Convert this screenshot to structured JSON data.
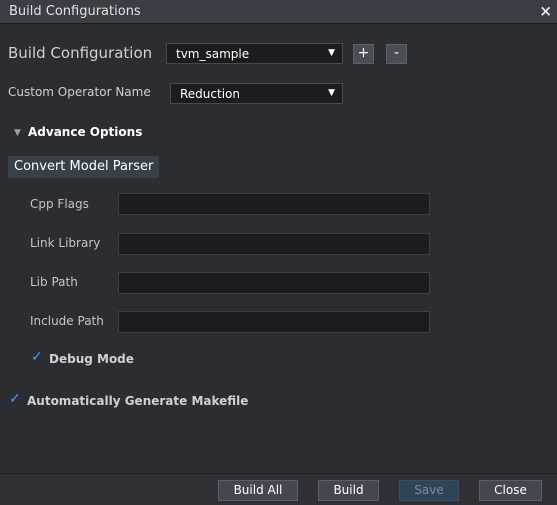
{
  "window": {
    "title": "Build Configurations"
  },
  "build_config": {
    "label": "Build Configuration",
    "value": "tvm_sample",
    "add_label": "+",
    "remove_label": "-"
  },
  "operator": {
    "label": "Custom Operator Name",
    "value": "Reduction"
  },
  "advance": {
    "title": "Advance Options",
    "tab_label": "Convert Model Parser",
    "fields": [
      {
        "label": "Cpp Flags",
        "value": ""
      },
      {
        "label": "Link Library",
        "value": ""
      },
      {
        "label": "Lib Path",
        "value": ""
      },
      {
        "label": "Include Path",
        "value": ""
      }
    ],
    "debug_mode": {
      "label": "Debug Mode",
      "checked": true
    }
  },
  "auto_makefile": {
    "label": "Automatically Generate Makefile",
    "checked": true
  },
  "footer": {
    "build_all": "Build All",
    "build": "Build",
    "save": "Save",
    "close": "Close"
  },
  "icons": {
    "close": "×",
    "dropdown": "▼",
    "expanded": "▼",
    "check": "✓"
  },
  "colors": {
    "accent": "#4a9eff",
    "background": "#2b2d31",
    "input": "#1b1c1e"
  }
}
